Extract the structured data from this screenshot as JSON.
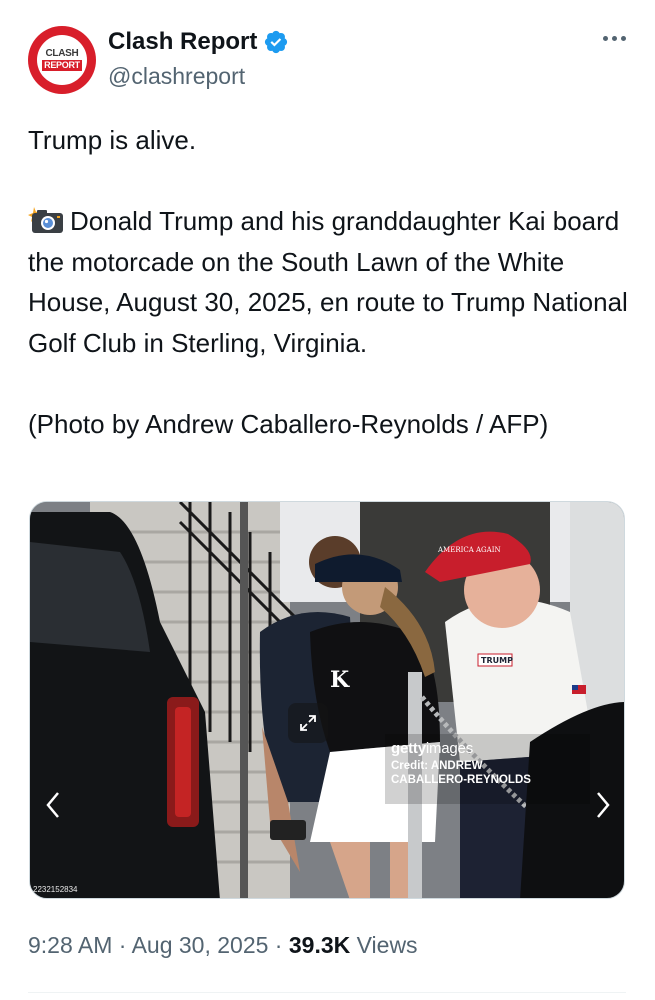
{
  "author": {
    "display_name": "Clash Report",
    "handle": "@clashreport",
    "avatar_text_top": "CLASH",
    "avatar_text_bottom": "REPORT",
    "verified": true
  },
  "tweet": {
    "line1": "Trump is alive.",
    "body": "Donald Trump and his granddaughter Kai board the motorcade on the South Lawn of the White House, August 30, 2025, en route to Trump National Golf Club in Sterling, Virginia.",
    "credit": "(Photo by Andrew Caballero-Reynolds / AFP)"
  },
  "photo": {
    "watermark_brand": "getty",
    "watermark_brand_light": "images",
    "watermark_credit_line1": "Credit: ANDREW",
    "watermark_credit_line2": "CABALLERO-REYNOLDS",
    "photo_id": "2232152834",
    "hat_text": "AMERICA AGAIN",
    "shirt_logo": "TRUMP"
  },
  "meta": {
    "time": "9:28 AM",
    "separator": " · ",
    "date": "Aug 30, 2025",
    "views_count": "39.3K",
    "views_label": " Views"
  },
  "colors": {
    "brand_red": "#d81e2a",
    "verified_blue": "#1d9bf0",
    "text_primary": "#0f1419",
    "text_secondary": "#536471"
  },
  "icons": [
    "verified-badge-icon",
    "more-icon",
    "camera-flash-icon",
    "expand-icon",
    "chevron-left-icon",
    "chevron-right-icon"
  ]
}
